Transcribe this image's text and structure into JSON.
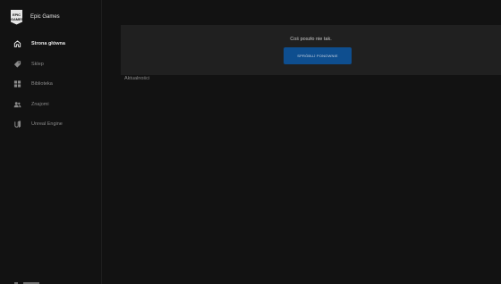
{
  "brand": {
    "logo_line1": "EPIC",
    "logo_line2": "GAMES",
    "name": "Epic Games"
  },
  "sidebar": {
    "items": [
      {
        "label": "Strona główna",
        "icon": "home-icon",
        "active": true
      },
      {
        "label": "Sklep",
        "icon": "tag-icon",
        "active": false
      },
      {
        "label": "Biblioteka",
        "icon": "grid-icon",
        "active": false
      },
      {
        "label": "Znajomi",
        "icon": "friends-icon",
        "active": false
      },
      {
        "label": "Unreal Engine",
        "icon": "unreal-icon",
        "active": false
      }
    ]
  },
  "main": {
    "error_message": "Coś poszło nie tak.",
    "retry_label": "Spróbuj ponownie",
    "section_label": "Aktualności"
  },
  "colors": {
    "background": "#121212",
    "panel": "#202020",
    "accent": "#0e4e8f",
    "text_primary": "#e6e6e6",
    "text_secondary": "#8a8a8a"
  }
}
